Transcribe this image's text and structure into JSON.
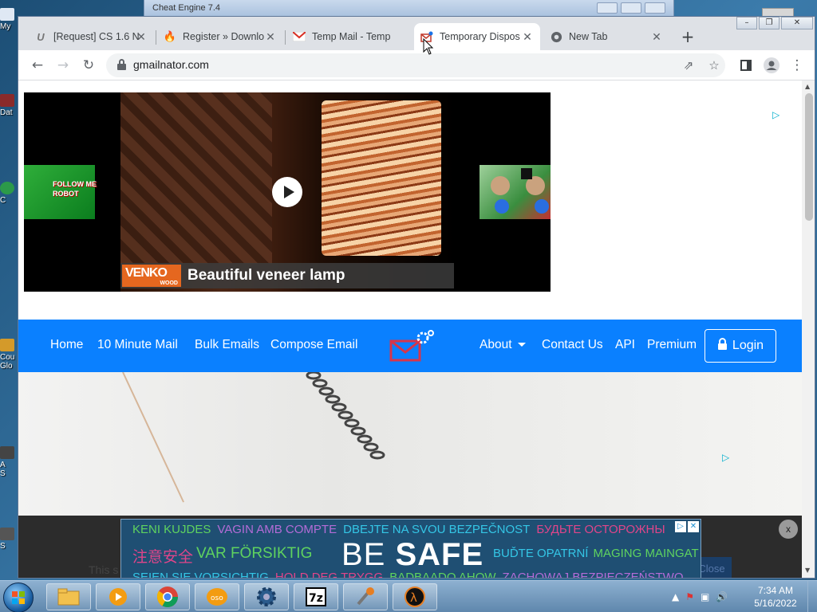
{
  "desktop": {
    "icons": [
      "My",
      "Dat",
      "C",
      "Cou\nGlo",
      "A\nS",
      "S"
    ]
  },
  "background_window": {
    "title": "Cheat Engine 7.4"
  },
  "browser": {
    "tabs": [
      {
        "label": "[Request] CS 1.6 N",
        "icon": "ue-icon"
      },
      {
        "label": "Register » Downlo",
        "icon": "flame-icon"
      },
      {
        "label": "Temp Mail - Temp",
        "icon": "gmail-icon"
      },
      {
        "label": "Temporary Dispos",
        "icon": "mail-gear-icon"
      },
      {
        "label": "New Tab",
        "icon": "chrome-icon"
      }
    ],
    "url": "gmailnator.com"
  },
  "ad_video": {
    "brand": "VENKO",
    "brand_sub": "WOOD",
    "caption": "Beautiful veneer lamp",
    "thumb_left_text": "FOLLOW ME\nROBOT"
  },
  "nav": {
    "home": "Home",
    "ten_minute": "10 Minute Mail",
    "bulk": "Bulk Emails",
    "compose": "Compose Email",
    "about": "About",
    "contact": "Contact Us",
    "api": "API",
    "premium": "Premium",
    "login": "Login",
    "brand_color": "#0a80ff"
  },
  "banner": {
    "hidden_text": "This s",
    "hidden_close": "Close",
    "close_x": "x",
    "row1": [
      {
        "text": "KENI KUJDES",
        "color": "#5fd35f"
      },
      {
        "text": "VAGIN AMB COMPTE",
        "color": "#b46cd7"
      },
      {
        "text": "DBEJTE NA SVOU BEZPEČNOST",
        "color": "#34c6e6"
      },
      {
        "text": "БУДЬТЕ ОСТОРОЖНЫ",
        "color": "#e0458a"
      }
    ],
    "row2_left": [
      {
        "text": "注意安全",
        "color": "#e0458a"
      },
      {
        "text": "VAR FÖRSIKTIG",
        "color": "#5fd35f"
      }
    ],
    "big_be": "BE",
    "big_safe": "SAFE",
    "row2_right": [
      {
        "text": "BUĎTE OPATRNÍ",
        "color": "#34c6e6"
      },
      {
        "text": "MAGING MAINGAT",
        "color": "#5fd35f"
      }
    ],
    "row3": [
      {
        "text": "SEIEN SIE VORSICHTIG",
        "color": "#34c6e6"
      },
      {
        "text": "HOLD DEG TRYGG",
        "color": "#e0458a"
      },
      {
        "text": "BADBAADO AHOW",
        "color": "#5fd35f"
      },
      {
        "text": "ZACHOWAJ BEZPIECZEŃSTWO",
        "color": "#b46cd7"
      }
    ]
  },
  "taskbar": {
    "time": "7:34 AM",
    "date": "5/16/2022",
    "apps": [
      "explorer-icon",
      "media-player-icon",
      "chrome-icon",
      "oso-icon",
      "cheat-engine-icon",
      "7zip-icon",
      "tool-icon",
      "half-life-icon"
    ]
  }
}
